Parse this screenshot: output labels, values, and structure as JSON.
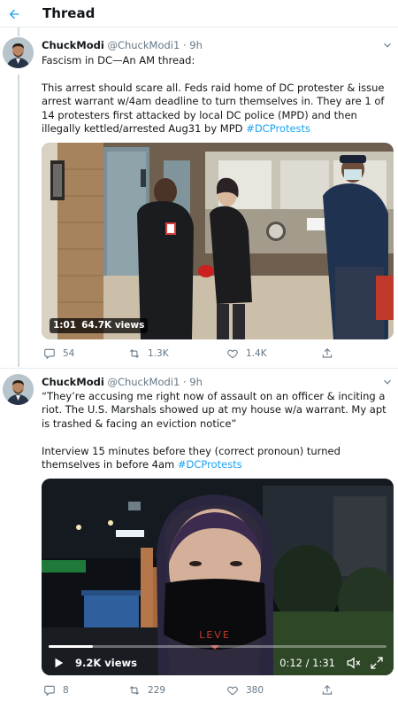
{
  "header": {
    "title": "Thread",
    "back_icon": "arrow-left-icon"
  },
  "colors": {
    "accent": "#1da1f2",
    "muted": "#657786",
    "divider": "#e6ecf0"
  },
  "tweets": [
    {
      "name": "ChuckModi",
      "handle": "@ChuckModi1",
      "separator": "·",
      "time": "9h",
      "paragraphs": [
        "Fascism in DC—An AM thread:",
        "This arrest should scare all. Feds raid home of DC protester & issue arrest warrant w/4am deadline to turn themselves in. They are 1 of 14 protesters first attacked by local DC police (MPD) and then illegally kettled/arrested Aug31 by MPD "
      ],
      "hashtag": "#DCProtests",
      "media": {
        "duration": "1:01",
        "views": "64.7K views"
      },
      "stats": {
        "replies": "54",
        "retweets": "1.3K",
        "likes": "1.4K"
      }
    },
    {
      "name": "ChuckModi",
      "handle": "@ChuckModi1",
      "separator": "·",
      "time": "9h",
      "paragraphs": [
        "“They’re accusing me right now of assault on an officer & inciting a riot. The U.S. Marshals showed up at my house w/a warrant. My apt is trashed & facing an eviction notice”",
        "Interview 15 minutes before they (correct pronoun) turned themselves in before 4am "
      ],
      "hashtag": "#DCProtests",
      "media": {
        "views": "9.2K views",
        "time": "0:12 / 1:31",
        "progress": 0.13,
        "mask_text": "LEVE"
      },
      "stats": {
        "replies": "8",
        "retweets": "229",
        "likes": "380"
      }
    }
  ]
}
